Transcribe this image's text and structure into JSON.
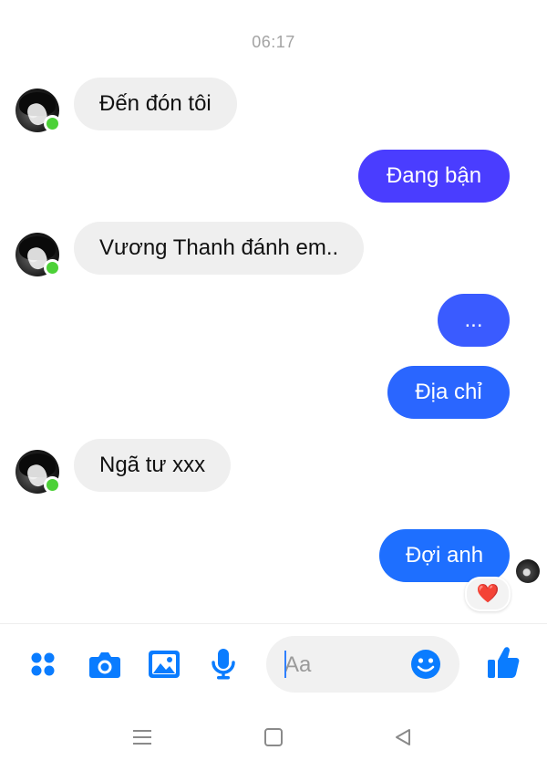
{
  "timestamp": "06:17",
  "messages": [
    {
      "text": "Đến đón tôi",
      "from": "other"
    },
    {
      "text": "Đang bận",
      "from": "me"
    },
    {
      "text": "Vương Thanh đánh em..",
      "from": "other"
    },
    {
      "text": "...",
      "from": "me"
    },
    {
      "text": "Địa chỉ",
      "from": "me"
    },
    {
      "text": "Ngã tư xxx",
      "from": "other"
    },
    {
      "text": "Đợi anh",
      "from": "me",
      "reaction": "❤️"
    }
  ],
  "composer": {
    "placeholder": "Aa"
  },
  "colors": {
    "accent": "#0a7cff",
    "bubble_out_1": "#4a3dff",
    "bubble_out_2": "#3a5bff",
    "bubble_out_3": "#2a66ff",
    "bubble_out_4": "#1e6fff",
    "bubble_in": "#efefef",
    "online": "#4cd137"
  },
  "icons": {
    "toolbar": [
      "menu-dots-icon",
      "camera-icon",
      "image-icon",
      "microphone-icon"
    ],
    "emoji": "smiley-icon",
    "send": "thumbs-up-icon",
    "navigation": [
      "recent-apps-icon",
      "home-icon",
      "back-icon"
    ]
  }
}
